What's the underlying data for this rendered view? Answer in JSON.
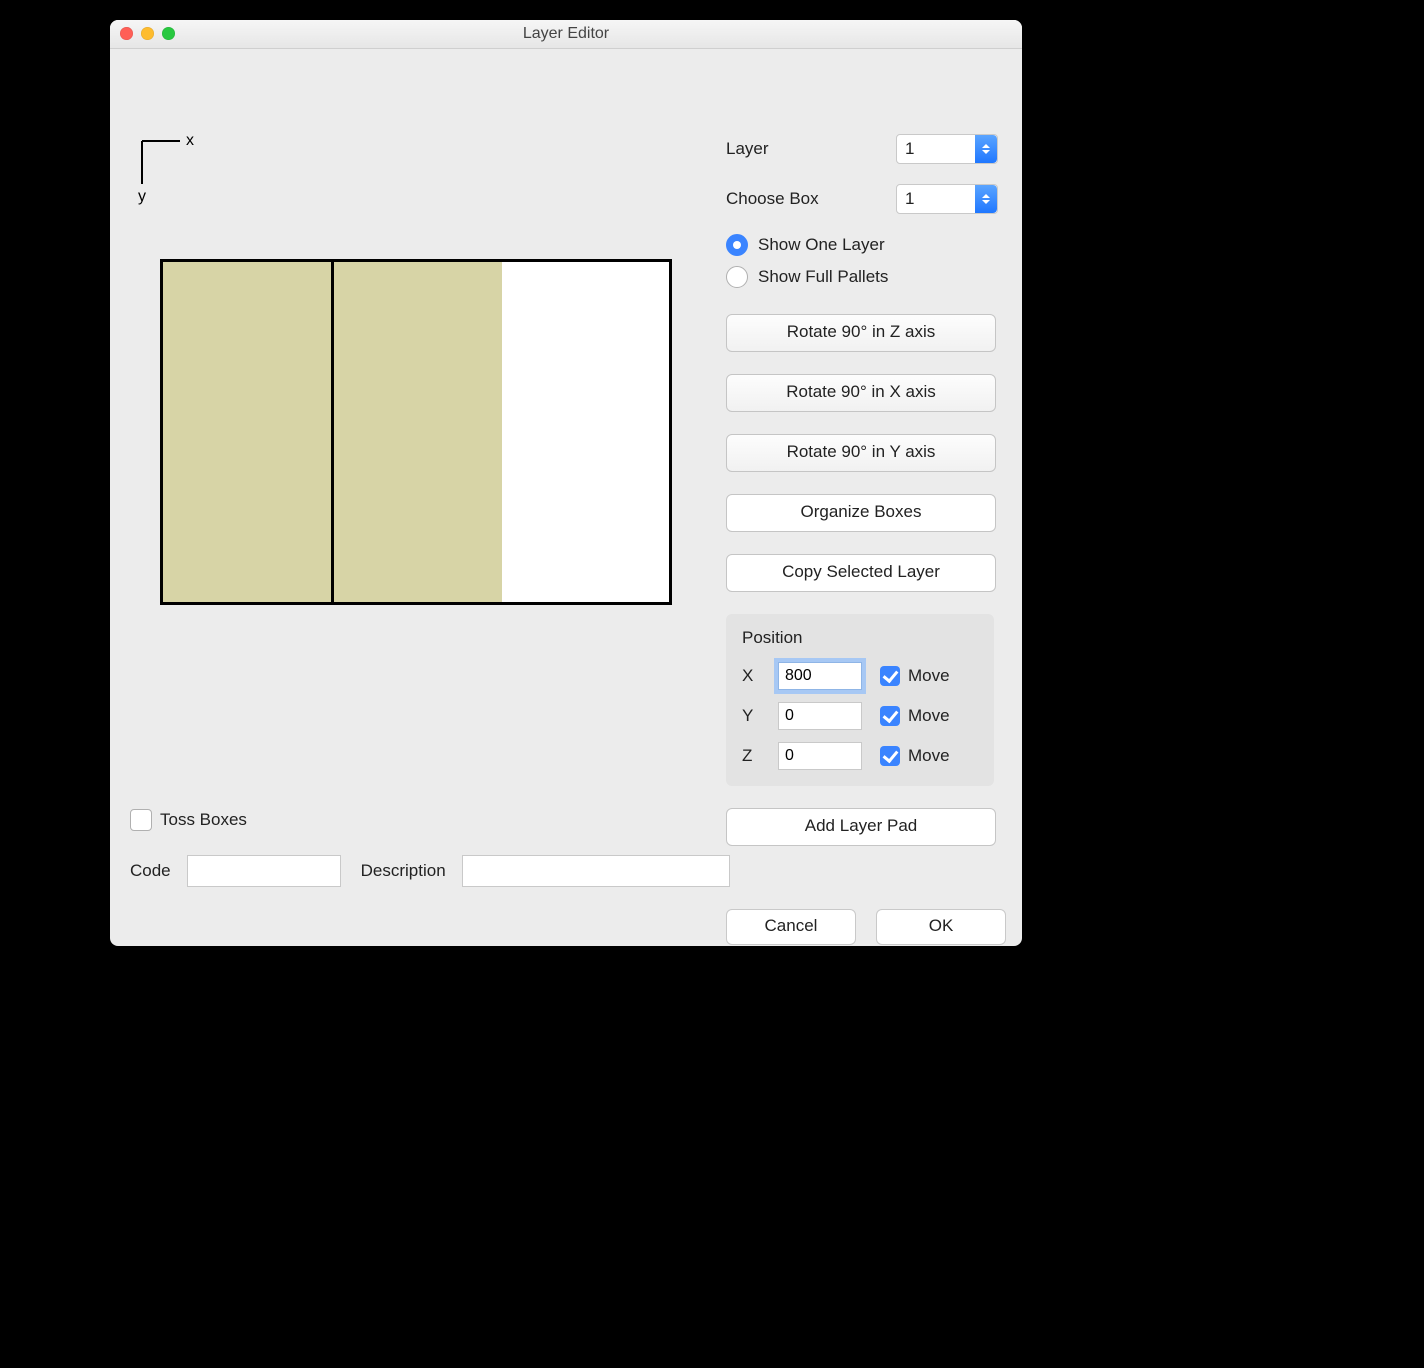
{
  "window": {
    "title": "Layer Editor"
  },
  "axes": {
    "x": "x",
    "y": "y"
  },
  "selectors": {
    "layer_label": "Layer",
    "layer_value": "1",
    "choose_box_label": "Choose Box",
    "choose_box_value": "1"
  },
  "view_mode": {
    "one_layer_label": "Show One Layer",
    "full_pallets_label": "Show Full Pallets",
    "selected": "one_layer"
  },
  "buttons": {
    "rotate_z": "Rotate 90° in Z axis",
    "rotate_x": "Rotate 90° in X axis",
    "rotate_y": "Rotate 90° in Y axis",
    "organize": "Organize Boxes",
    "copy_layer": "Copy Selected Layer",
    "add_pad": "Add Layer Pad",
    "cancel": "Cancel",
    "ok": "OK"
  },
  "position": {
    "title": "Position",
    "x_label": "X",
    "x_value": "800",
    "x_move_checked": true,
    "y_label": "Y",
    "y_value": "0",
    "y_move_checked": true,
    "z_label": "Z",
    "z_value": "0",
    "z_move_checked": true,
    "move_label": "Move"
  },
  "toss": {
    "label": "Toss Boxes",
    "checked": false
  },
  "code_row": {
    "code_label": "Code",
    "code_value": "",
    "desc_label": "Description",
    "desc_value": ""
  }
}
